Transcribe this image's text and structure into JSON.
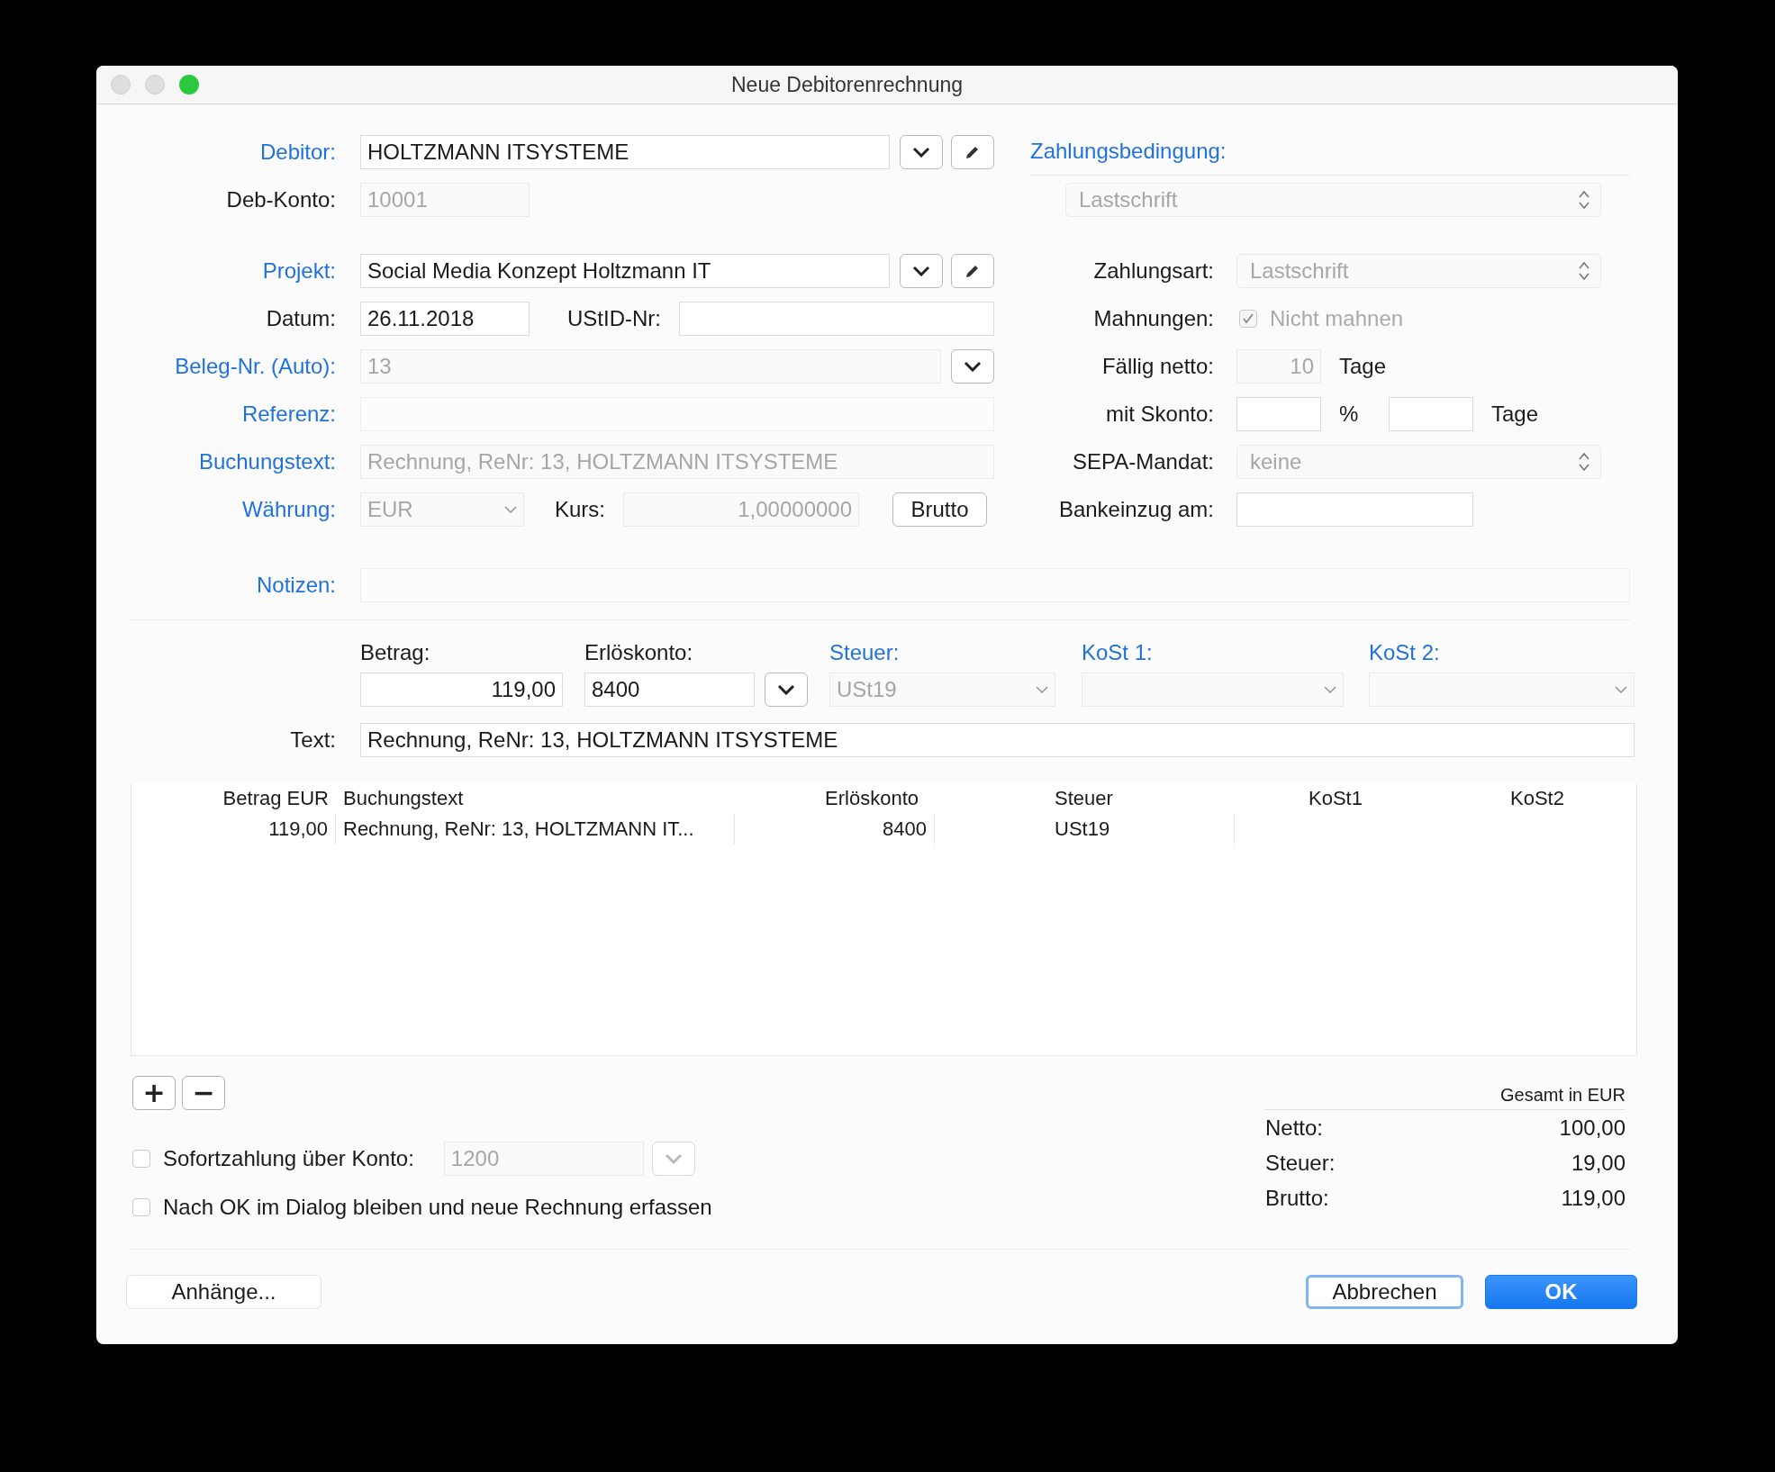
{
  "window": {
    "title": "Neue Debitorenrechnung"
  },
  "debitor": {
    "label": "Debitor:",
    "link": true,
    "value": "HOLTZMANN ITSYSTEME",
    "disabled": false
  },
  "deb_konto": {
    "label": "Deb-Konto:",
    "link": false,
    "value": "10001",
    "disabled": true
  },
  "projekt": {
    "label": "Projekt:",
    "link": true,
    "value": "Social Media Konzept Holtzmann IT",
    "disabled": false
  },
  "datum": {
    "label": "Datum:",
    "link": false,
    "value": "26.11.2018",
    "disabled": false
  },
  "ustid": {
    "label": "UStID-Nr:",
    "link": false
  },
  "beleg_nr": {
    "label": "Beleg-Nr. (Auto):",
    "link": true,
    "value": "13",
    "disabled": true
  },
  "referenz": {
    "label": "Referenz:",
    "link": true
  },
  "buchungstext": {
    "label": "Buchungstext:",
    "link": true,
    "value": "Rechnung, ReNr: 13, HOLTZMANN ITSYSTEME",
    "disabled": true
  },
  "waehrung": {
    "label": "Währung:",
    "link": true,
    "value": "EUR",
    "disabled": true
  },
  "kurs": {
    "label": "Kurs:",
    "link": false,
    "value": "1,00000000",
    "disabled": true
  },
  "brutto_button": "Brutto",
  "notizen": {
    "label": "Notizen:",
    "link": true
  },
  "zahlungsbedingung": {
    "label": "Zahlungsbedingung:",
    "link": true,
    "value": "Lastschrift",
    "disabled": true
  },
  "zahlungsart": {
    "label": "Zahlungsart:",
    "link": false,
    "value": "Lastschrift",
    "disabled": true
  },
  "mahnungen": {
    "label": "Mahnungen:",
    "link": false,
    "option": "Nicht mahnen",
    "checked": true,
    "disabled": true
  },
  "faellig_netto": {
    "label": "Fällig netto:",
    "link": false,
    "value": "10",
    "disabled": true,
    "unit": "Tage"
  },
  "mit_skonto": {
    "label": "mit Skonto:",
    "link": false,
    "percent_unit": "%",
    "days_unit": "Tage"
  },
  "sepa_mandat": {
    "label": "SEPA-Mandat:",
    "link": false,
    "value": "keine",
    "disabled": true
  },
  "bankeinzug": {
    "label": "Bankeinzug am:",
    "link": false
  },
  "entry": {
    "betrag": {
      "label": "Betrag:",
      "link": false,
      "value": "119,00",
      "disabled": false
    },
    "erloeskonto": {
      "label": "Erlöskonto:",
      "link": false,
      "value": "8400",
      "disabled": false
    },
    "steuer": {
      "label": "Steuer:",
      "link": true,
      "value": "USt19",
      "disabled": true
    },
    "kost1": {
      "label": "KoSt 1:",
      "link": true
    },
    "kost2": {
      "label": "KoSt 2:",
      "link": true
    },
    "text": {
      "label": "Text:",
      "link": false,
      "value": "Rechnung, ReNr: 13, HOLTZMANN ITSYSTEME",
      "disabled": false
    }
  },
  "table": {
    "columns": [
      "Betrag EUR",
      "Buchungstext",
      "Erlöskonto",
      "Steuer",
      "KoSt1",
      "KoSt2"
    ],
    "rows": [
      {
        "cells": [
          "119,00",
          "Rechnung, ReNr: 13, HOLTZMANN IT...",
          "8400",
          "USt19",
          "",
          ""
        ]
      }
    ]
  },
  "row_buttons": [
    "+",
    "−"
  ],
  "sofortzahlung": {
    "label": "Sofortzahlung über Konto:",
    "checked": false,
    "value": "1200",
    "disabled": true
  },
  "dialog_bleiben": {
    "label": "Nach OK im Dialog bleiben und neue Rechnung erfassen",
    "checked": false
  },
  "totals": {
    "heading": "Gesamt in EUR",
    "rows": [
      {
        "label": "Netto:",
        "value": "100,00"
      },
      {
        "label": "Steuer:",
        "value": "19,00"
      },
      {
        "label": "Brutto:",
        "value": "119,00"
      }
    ]
  },
  "buttons": {
    "attachments": "Anhänge...",
    "cancel": "Abbrechen",
    "ok": "OK"
  }
}
